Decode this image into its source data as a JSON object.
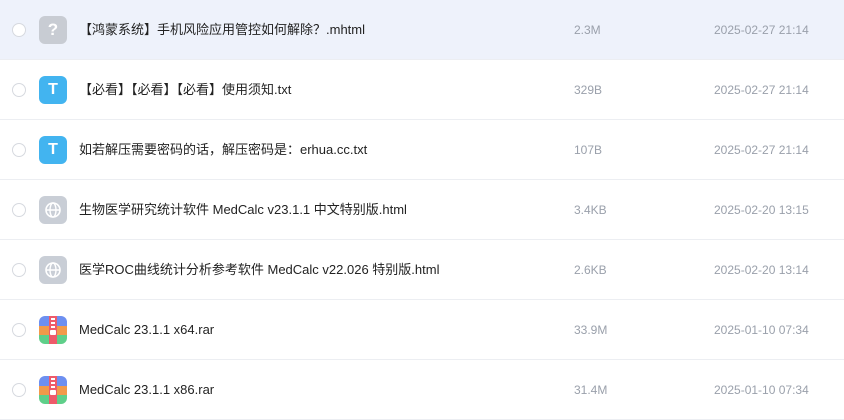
{
  "files": [
    {
      "name": "【鸿蒙系统】手机风险应用管控如何解除？.mhtml",
      "size": "2.3M",
      "date": "2025-02-27 21:14",
      "icon": "unknown-file-icon",
      "glyph": "?"
    },
    {
      "name": "【必看】【必看】【必看】使用须知.txt",
      "size": "329B",
      "date": "2025-02-27 21:14",
      "icon": "text-file-icon",
      "glyph": "T"
    },
    {
      "name": "如若解压需要密码的话，解压密码是：erhua.cc.txt",
      "size": "107B",
      "date": "2025-02-27 21:14",
      "icon": "text-file-icon",
      "glyph": "T"
    },
    {
      "name": "生物医学研究统计软件 MedCalc v23.1.1 中文特别版.html",
      "size": "3.4KB",
      "date": "2025-02-20 13:15",
      "icon": "web-file-icon"
    },
    {
      "name": "医学ROC曲线统计分析参考软件 MedCalc v22.026 特别版.html",
      "size": "2.6KB",
      "date": "2025-02-20 13:14",
      "icon": "web-file-icon"
    },
    {
      "name": "MedCalc 23.1.1 x64.rar",
      "size": "33.9M",
      "date": "2025-01-10 07:34",
      "icon": "archive-file-icon"
    },
    {
      "name": "MedCalc 23.1.1 x86.rar",
      "size": "31.4M",
      "date": "2025-01-10 07:34",
      "icon": "archive-file-icon"
    }
  ],
  "colors": {
    "hover_row": "#eef2fb",
    "text_primary": "#222222",
    "text_secondary": "#9aa0ab",
    "txt_icon": "#42b4f0",
    "unknown_icon": "#c8ccd3"
  }
}
